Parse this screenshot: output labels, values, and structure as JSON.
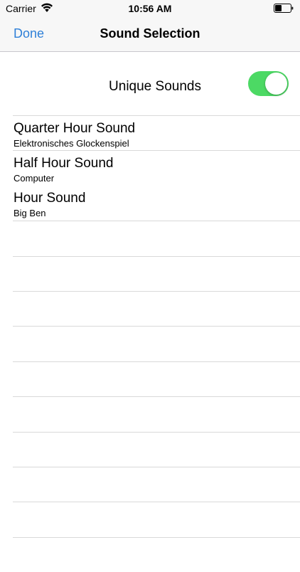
{
  "status_bar": {
    "carrier": "Carrier",
    "time": "10:56 AM",
    "icons": [
      "wifi-icon",
      "battery-icon"
    ]
  },
  "nav": {
    "done_label": "Done",
    "title": "Sound Selection"
  },
  "unique_sounds": {
    "label": "Unique Sounds",
    "enabled": true
  },
  "sounds": [
    {
      "title": "Quarter Hour Sound",
      "subtitle": "Elektronisches Glockenspiel"
    },
    {
      "title": "Half Hour Sound",
      "subtitle": "Computer"
    },
    {
      "title": "Hour Sound",
      "subtitle": "Big Ben"
    }
  ],
  "colors": {
    "accent": "#2f80d8",
    "toggle_on": "#4cd964",
    "bar_background": "#f7f7f7",
    "separator": "#d9d9d9"
  }
}
